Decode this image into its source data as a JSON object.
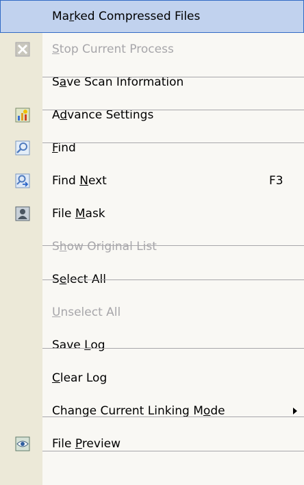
{
  "menu": {
    "items": [
      {
        "pre": "Ma",
        "acc": "r",
        "post": "ked Compressed Files",
        "shortcut": "",
        "submenu": false,
        "disabled": false,
        "highlight": true,
        "icon": "none"
      },
      {
        "pre": "",
        "acc": "S",
        "post": "top Current Process",
        "shortcut": "",
        "submenu": false,
        "disabled": true,
        "highlight": false,
        "icon": "stop-icon"
      },
      {
        "pre": "S",
        "acc": "a",
        "post": "ve Scan Information",
        "shortcut": "",
        "submenu": false,
        "disabled": false,
        "highlight": false,
        "icon": "none"
      },
      {
        "pre": "A",
        "acc": "d",
        "post": "vance Settings",
        "shortcut": "",
        "submenu": false,
        "disabled": false,
        "highlight": false,
        "icon": "settings-icon"
      },
      {
        "pre": "",
        "acc": "F",
        "post": "ind",
        "shortcut": "",
        "submenu": false,
        "disabled": false,
        "highlight": false,
        "icon": "find-icon"
      },
      {
        "pre": "Find ",
        "acc": "N",
        "post": "ext",
        "shortcut": "F3",
        "submenu": false,
        "disabled": false,
        "highlight": false,
        "icon": "find-next-icon"
      },
      {
        "pre": "File ",
        "acc": "M",
        "post": "ask",
        "shortcut": "",
        "submenu": false,
        "disabled": false,
        "highlight": false,
        "icon": "file-mask-icon"
      },
      {
        "pre": "S",
        "acc": "h",
        "post": "ow Original List",
        "shortcut": "",
        "submenu": false,
        "disabled": true,
        "highlight": false,
        "icon": "none"
      },
      {
        "pre": "S",
        "acc": "e",
        "post": "lect All",
        "shortcut": "",
        "submenu": false,
        "disabled": false,
        "highlight": false,
        "icon": "none"
      },
      {
        "pre": "",
        "acc": "U",
        "post": "nselect All",
        "shortcut": "",
        "submenu": false,
        "disabled": true,
        "highlight": false,
        "icon": "none"
      },
      {
        "pre": "Save ",
        "acc": "L",
        "post": "og",
        "shortcut": "",
        "submenu": false,
        "disabled": false,
        "highlight": false,
        "icon": "none"
      },
      {
        "pre": "",
        "acc": "C",
        "post": "lear Log",
        "shortcut": "",
        "submenu": false,
        "disabled": false,
        "highlight": false,
        "icon": "none"
      },
      {
        "pre": "Change Current Linking M",
        "acc": "o",
        "post": "de",
        "shortcut": "",
        "submenu": true,
        "disabled": false,
        "highlight": false,
        "icon": "none"
      },
      {
        "pre": "File ",
        "acc": "P",
        "post": "review",
        "shortcut": "",
        "submenu": false,
        "disabled": false,
        "highlight": false,
        "icon": "eye-icon"
      }
    ]
  }
}
